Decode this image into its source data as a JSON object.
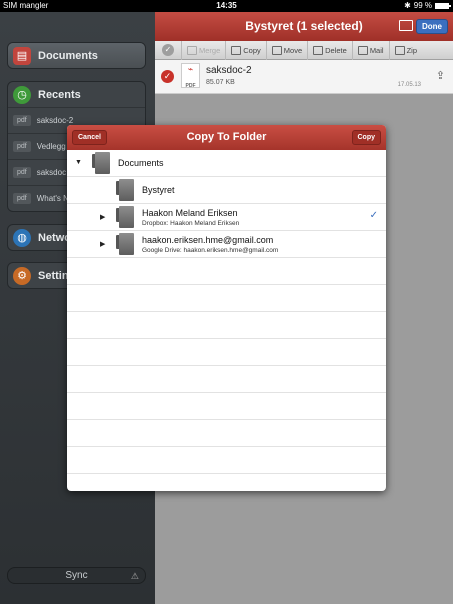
{
  "status_bar": {
    "carrier": "SIM mangler",
    "time": "14:35",
    "battery": "99 %"
  },
  "sidebar": {
    "documents_label": "Documents",
    "recents_label": "Recents",
    "recent_items": [
      {
        "tag": "pdf",
        "name": "saksdoc-2"
      },
      {
        "tag": "pdf",
        "name": "Vedlegg"
      },
      {
        "tag": "pdf",
        "name": "saksdoc"
      },
      {
        "tag": "pdf",
        "name": "What's N"
      }
    ],
    "network_label": "Netwo",
    "settings_label": "Settings",
    "sync_label": "Sync"
  },
  "main": {
    "title": "Bystyret (1 selected)",
    "done_label": "Done",
    "toolbar": {
      "merge": "Merge",
      "copy": "Copy",
      "move": "Move",
      "delete": "Delete",
      "mail": "Mail",
      "zip": "Zip"
    },
    "file": {
      "name": "saksdoc-2",
      "size": "85.07 KB",
      "date": "17.05.13",
      "type": "PDF"
    }
  },
  "dialog": {
    "title": "Copy To Folder",
    "cancel_label": "Cancel",
    "copy_label": "Copy",
    "rows": [
      {
        "label": "Documents",
        "sublabel": ""
      },
      {
        "label": "Bystyret",
        "sublabel": ""
      },
      {
        "label": "Haakon Meland Eriksen",
        "sublabel": "Dropbox: Haakon Meland Eriksen"
      },
      {
        "label": "haakon.eriksen.hme@gmail.com",
        "sublabel": "Google Drive: haakon.eriksen.hme@gmail.com"
      }
    ]
  }
}
